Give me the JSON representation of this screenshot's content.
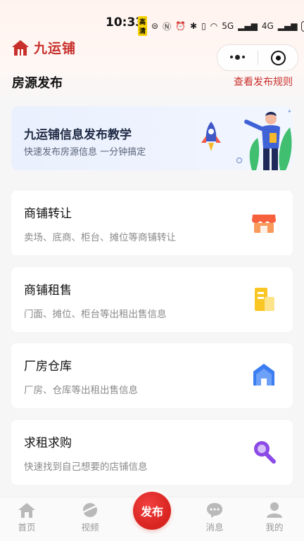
{
  "status_bar": {
    "time": "10:33",
    "hd": "高清",
    "signal1": "5G",
    "signal2": "4G",
    "battery": "54"
  },
  "header": {
    "brand": "九运铺",
    "page_title": "房源发布",
    "rules_link": "查看发布规则"
  },
  "banner": {
    "title": "九运铺信息发布教学",
    "subtitle": "快速发布房源信息  一分钟搞定"
  },
  "categories": [
    {
      "title": "商铺转让",
      "desc": "卖场、底商、柜台、摊位等商铺转让",
      "icon": "shop-icon"
    },
    {
      "title": "商铺租售",
      "desc": "门面、摊位、柜台等出租出售信息",
      "icon": "building-icon"
    },
    {
      "title": "厂房仓库",
      "desc": "厂房、仓库等出租出售信息",
      "icon": "warehouse-icon"
    },
    {
      "title": "求租求购",
      "desc": "快速找到自己想要的店铺信息",
      "icon": "search-icon"
    }
  ],
  "tabbar": {
    "home": "首页",
    "video": "视频",
    "publish": "发布",
    "messages": "消息",
    "mine": "我的"
  },
  "colors": {
    "brand": "#c8302c",
    "accent": "#d8231f"
  }
}
